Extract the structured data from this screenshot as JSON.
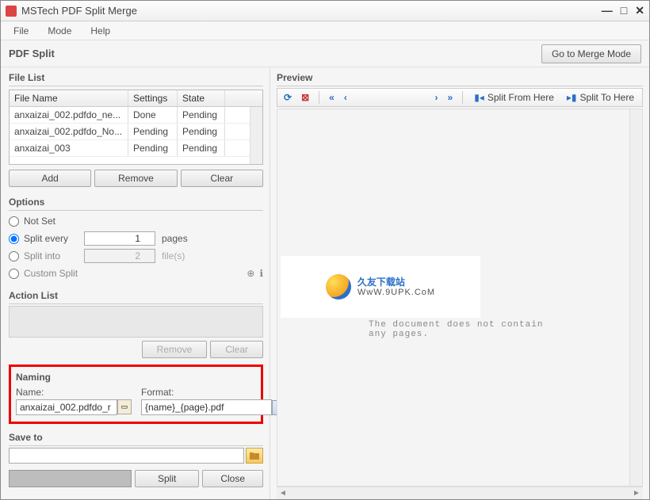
{
  "window": {
    "title": "MSTech PDF Split Merge"
  },
  "menu": {
    "file": "File",
    "mode": "Mode",
    "help": "Help"
  },
  "header": {
    "section": "PDF Split",
    "merge_btn": "Go to Merge Mode"
  },
  "filelist": {
    "label": "File List",
    "col_name": "File Name",
    "col_settings": "Settings",
    "col_state": "State",
    "rows": [
      {
        "name": "anxaizai_002.pdfdo_ne...",
        "settings": "Done",
        "state": "Pending"
      },
      {
        "name": "anxaizai_002.pdfdo_No...",
        "settings": "Pending",
        "state": "Pending"
      },
      {
        "name": "anxaizai_003",
        "settings": "Pending",
        "state": "Pending"
      }
    ],
    "add_btn": "Add",
    "remove_btn": "Remove",
    "clear_btn": "Clear"
  },
  "options": {
    "label": "Options",
    "not_set": "Not Set",
    "split_every": "Split every",
    "split_every_val": "1",
    "split_every_unit": "pages",
    "split_into": "Split into",
    "split_into_val": "2",
    "split_into_unit": "file(s)",
    "custom": "Custom Split"
  },
  "actionlist": {
    "label": "Action List",
    "remove_btn": "Remove",
    "clear_btn": "Clear"
  },
  "naming": {
    "label": "Naming",
    "name_lbl": "Name:",
    "name_val": "anxaizai_002.pdfdo_r",
    "format_lbl": "Format:",
    "format_val": "{name}_{page}.pdf"
  },
  "saveto": {
    "label": "Save to",
    "path": ""
  },
  "bottom": {
    "split_btn": "Split",
    "close_btn": "Close"
  },
  "preview": {
    "label": "Preview",
    "split_from": "Split From Here",
    "split_to": "Split To Here",
    "empty_msg": "The document does not contain any pages.",
    "watermark_main": "久友下载站",
    "watermark_sub": "WwW.9UPK.CoM"
  }
}
